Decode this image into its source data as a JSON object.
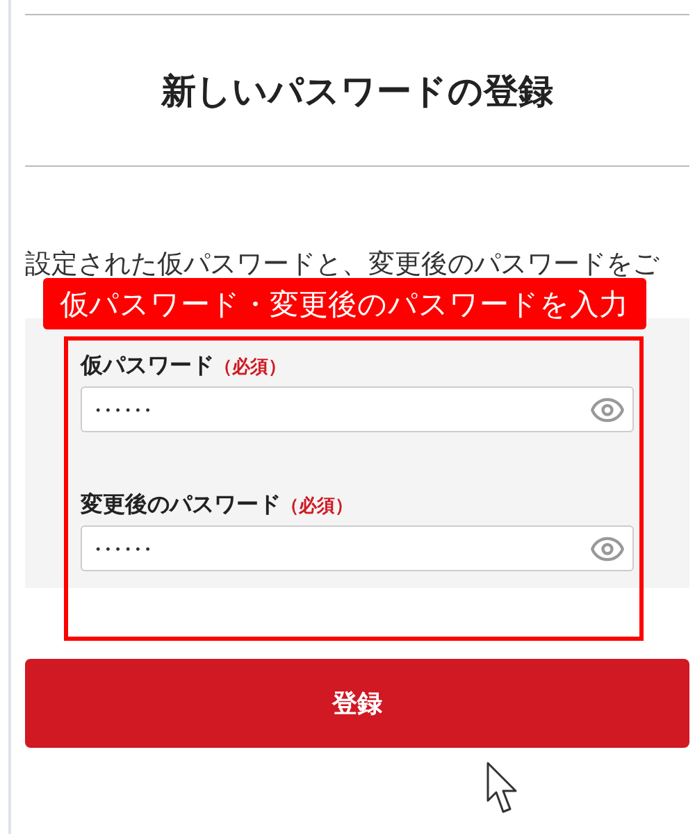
{
  "page": {
    "title": "新しいパスワードの登録",
    "description": "設定された仮パスワードと、変更後のパスワードをご"
  },
  "form": {
    "fields": [
      {
        "label": "仮パスワード",
        "required": "（必須）",
        "value": "••••••"
      },
      {
        "label": "変更後のパスワード",
        "required": "（必須）",
        "value": "••••••"
      }
    ]
  },
  "submit_button": "登録",
  "annotation": {
    "label": "仮パスワード・変更後のパスワードを入力"
  }
}
